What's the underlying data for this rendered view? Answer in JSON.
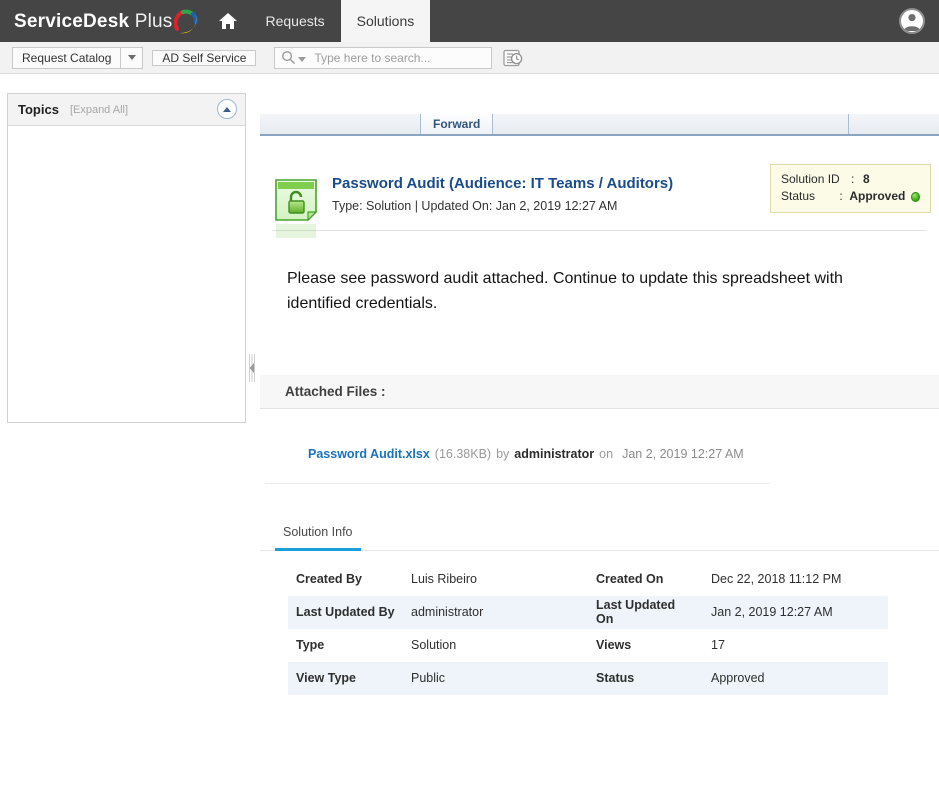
{
  "header": {
    "brand_bold": "ServiceDesk",
    "brand_light": " Plus",
    "home_icon": "home-icon",
    "tabs": [
      {
        "label": "Requests",
        "active": false
      },
      {
        "label": "Solutions",
        "active": true
      }
    ],
    "avatar_icon": "user-avatar-icon"
  },
  "toolbar": {
    "request_catalog_label": "Request Catalog",
    "catalog_caret_icon": "chevron-down-icon",
    "ad_self_service_label": "AD Self Service",
    "search": {
      "placeholder": "Type here to search...",
      "value": "",
      "icon": "search-icon",
      "caret_icon": "chevron-down-icon"
    },
    "history_icon": "recent-history-icon"
  },
  "sidebar": {
    "title": "Topics",
    "expand_all_label": "[Expand All]",
    "collapse_icon": "chevron-up-circle-icon",
    "items": []
  },
  "splitter": {
    "icon": "collapse-left-handle-icon"
  },
  "action_bar": {
    "forward_label": "Forward"
  },
  "solution": {
    "icon": "green-open-padlock-solution-icon",
    "title": "Password Audit (Audience: IT Teams / Auditors)",
    "meta_type_label": "Type: Solution",
    "meta_separator": "|",
    "meta_updated_label": "Updated On: Jan 2, 2019 12:27 AM",
    "meta_line": "Type: Solution | Updated On: Jan 2, 2019 12:27 AM",
    "id_label": "Solution ID",
    "id_colon": ":",
    "id_value": "8",
    "status_label": "Status",
    "status_colon": ":",
    "status_value": "Approved",
    "status_dot_icon": "green-status-dot-icon",
    "status_color": "#46b81c",
    "body_text": "Please see password audit attached.  Continue to update this spreadsheet with identified credentials."
  },
  "attachments": {
    "band_title": "Attached Files :",
    "files": [
      {
        "name": "Password Audit.xlsx",
        "size": "(16.38KB)",
        "by_label": "by",
        "user": "administrator",
        "on_label": "on",
        "date": "Jan 2, 2019 12:27 AM"
      }
    ]
  },
  "info": {
    "tabs": [
      {
        "label": "Solution Info",
        "active": true
      }
    ],
    "rows": [
      {
        "k1": "Created By",
        "v1": "Luis Ribeiro",
        "k2": "Created On",
        "v2": "Dec 22, 2018 11:12 PM"
      },
      {
        "k1": "Last Updated By",
        "v1": "administrator",
        "k2": "Last Updated On",
        "v2": "Jan 2, 2019 12:27 AM"
      },
      {
        "k1": "Type",
        "v1": "Solution",
        "k2": "Views",
        "v2": "17"
      },
      {
        "k1": "View Type",
        "v1": "Public",
        "k2": "Status",
        "v2": "Approved"
      }
    ]
  }
}
